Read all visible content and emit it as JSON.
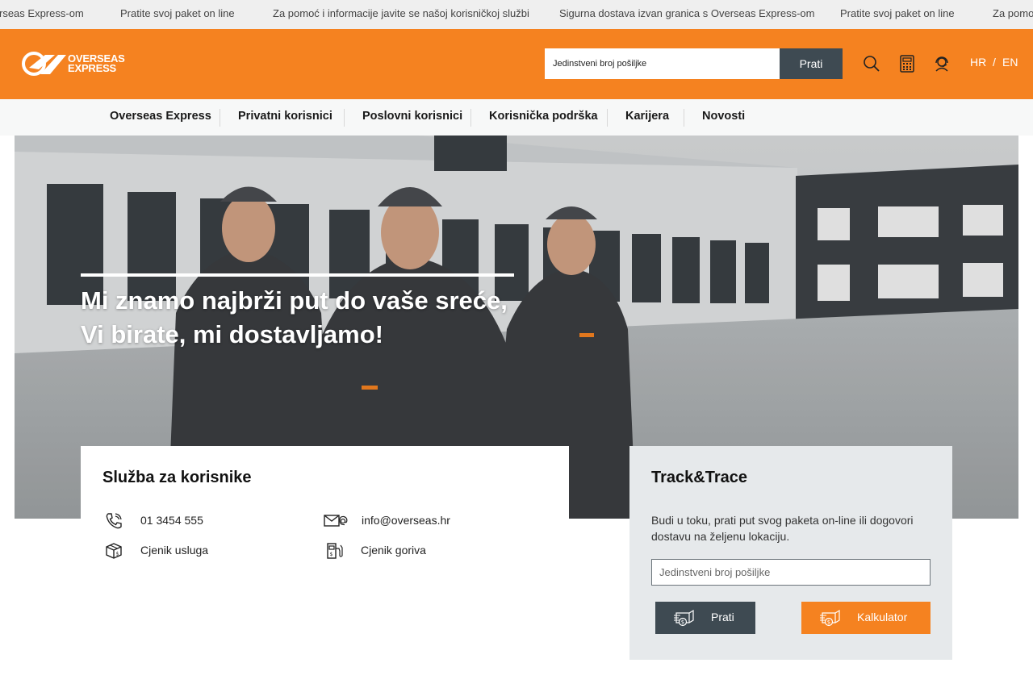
{
  "ticker": [
    "rseas Express-om",
    "Pratite svoj paket on line",
    "Za pomoć i informacije javite se našoj korisničkoj službi",
    "Sigurna dostava izvan granica s Overseas Express-om",
    "Pratite svoj paket on line",
    "Za pomo"
  ],
  "header": {
    "logo_line1": "OVERSEAS",
    "logo_line2": "EXPRESS",
    "search_placeholder": "Jedinstveni broj pošiljke",
    "search_button": "Prati",
    "lang_hr": "HR",
    "lang_sep": "/",
    "lang_en": "EN"
  },
  "nav": [
    "Overseas Express",
    "Privatni korisnici",
    "Poslovni korisnici",
    "Korisnička podrška",
    "Karijera",
    "Novosti"
  ],
  "hero": {
    "title_line1": "Mi znamo najbrži put do vaše sreće,",
    "title_line2": "Vi birate, mi dostavljamo!"
  },
  "service": {
    "title": "Služba za korisnike",
    "phone": "01 3454 555",
    "email": "info@overseas.hr",
    "pricelist": "Cjenik usluga",
    "fuel": "Cjenik goriva"
  },
  "track": {
    "title": "Track&Trace",
    "description": "Budi u toku, prati put svog paketa on-line ili dogovori dostavu na željenu lokaciju.",
    "input_placeholder": "Jedinstveni broj pošiljke",
    "track_button": "Prati",
    "calc_button": "Kalkulator"
  },
  "colors": {
    "brand_orange": "#f58220",
    "dark_slate": "#3e4a52",
    "panel_grey": "#e6e9eb"
  },
  "icons": [
    "search-icon",
    "calculator-icon",
    "headset-icon",
    "phone-icon",
    "envelope-at-icon",
    "package-icon",
    "fuel-pump-icon",
    "box-cash-icon"
  ]
}
